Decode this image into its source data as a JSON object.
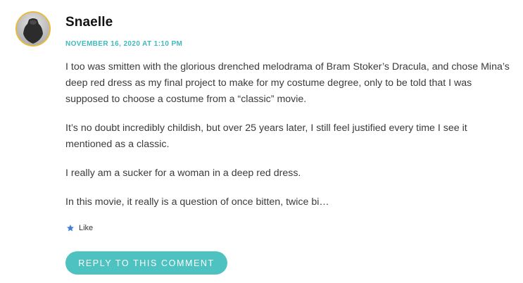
{
  "comment": {
    "author": "Snaelle",
    "timestamp": "NOVEMBER 16, 2020 AT 1:10 PM",
    "paragraphs": [
      "I too was smitten with the glorious drenched melodrama of Bram Stoker’s Dracula, and chose Mina’s deep red dress as my final project to make for my costume degree, only to be told that I was supposed to choose a costume from a “classic” movie.",
      "It’s no doubt incredibly childish, but over 25 years later, I still feel justified every time I see it mentioned as a classic.",
      "I really am a sucker for a woman in a deep red dress.",
      "In this movie, it really is a question of once bitten, twice bi…"
    ],
    "like_label": "Like",
    "reply_label": "REPLY TO THIS COMMENT"
  },
  "colors": {
    "accent": "#3fb9bd",
    "button": "#4dc2c0",
    "avatar_ring": "#e7b93c",
    "like_star": "#3f7fd6"
  },
  "icons": {
    "avatar": "mannequin-avatar",
    "like": "star-icon"
  }
}
